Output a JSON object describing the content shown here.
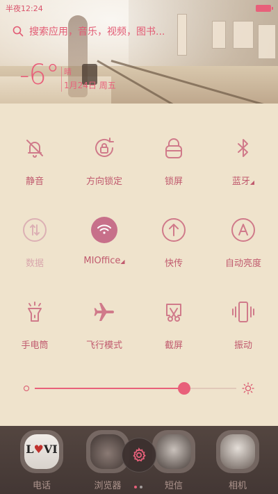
{
  "status": {
    "time": "半夜12:24"
  },
  "search": {
    "placeholder": "搜索应用，音乐，视频，图书..."
  },
  "weather": {
    "temperature": "-6°",
    "small": "晴",
    "date": "1月24日 周五"
  },
  "toggles": [
    {
      "label": "静音",
      "icon": "bell-off-icon",
      "active": false,
      "dim": false
    },
    {
      "label": "方向锁定",
      "icon": "rotation-lock-icon",
      "active": false,
      "dim": false
    },
    {
      "label": "锁屏",
      "icon": "lock-icon",
      "active": false,
      "dim": false
    },
    {
      "label": "蓝牙",
      "icon": "bluetooth-icon",
      "active": false,
      "dim": false,
      "has_more": true
    },
    {
      "label": "数据",
      "icon": "mobile-data-icon",
      "active": false,
      "dim": true
    },
    {
      "label": "MIOffice",
      "icon": "wifi-icon",
      "active": true,
      "dim": false,
      "has_more": true
    },
    {
      "label": "快传",
      "icon": "quick-transfer-icon",
      "active": false,
      "dim": false
    },
    {
      "label": "自动亮度",
      "icon": "auto-brightness-icon",
      "active": false,
      "dim": false
    },
    {
      "label": "手电筒",
      "icon": "flashlight-icon",
      "active": false,
      "dim": false
    },
    {
      "label": "飞行模式",
      "icon": "airplane-icon",
      "active": false,
      "dim": false
    },
    {
      "label": "截屏",
      "icon": "screenshot-icon",
      "active": false,
      "dim": false
    },
    {
      "label": "振动",
      "icon": "vibrate-icon",
      "active": false,
      "dim": false
    }
  ],
  "brightness": {
    "level": 0.74
  },
  "dock": {
    "apps": [
      {
        "label": "电话",
        "icon": "phone-app-icon"
      },
      {
        "label": "浏览器",
        "icon": "browser-app-icon"
      },
      {
        "label": "短信",
        "icon": "messages-app-icon"
      },
      {
        "label": "相机",
        "icon": "camera-app-icon"
      }
    ],
    "love_text": {
      "l": "L",
      "heart": "♥",
      "rest": "VI"
    }
  },
  "colors": {
    "accent": "#e8607a",
    "label": "#c05a6e",
    "active": "#c7708a",
    "panel": "#efe3cc"
  }
}
